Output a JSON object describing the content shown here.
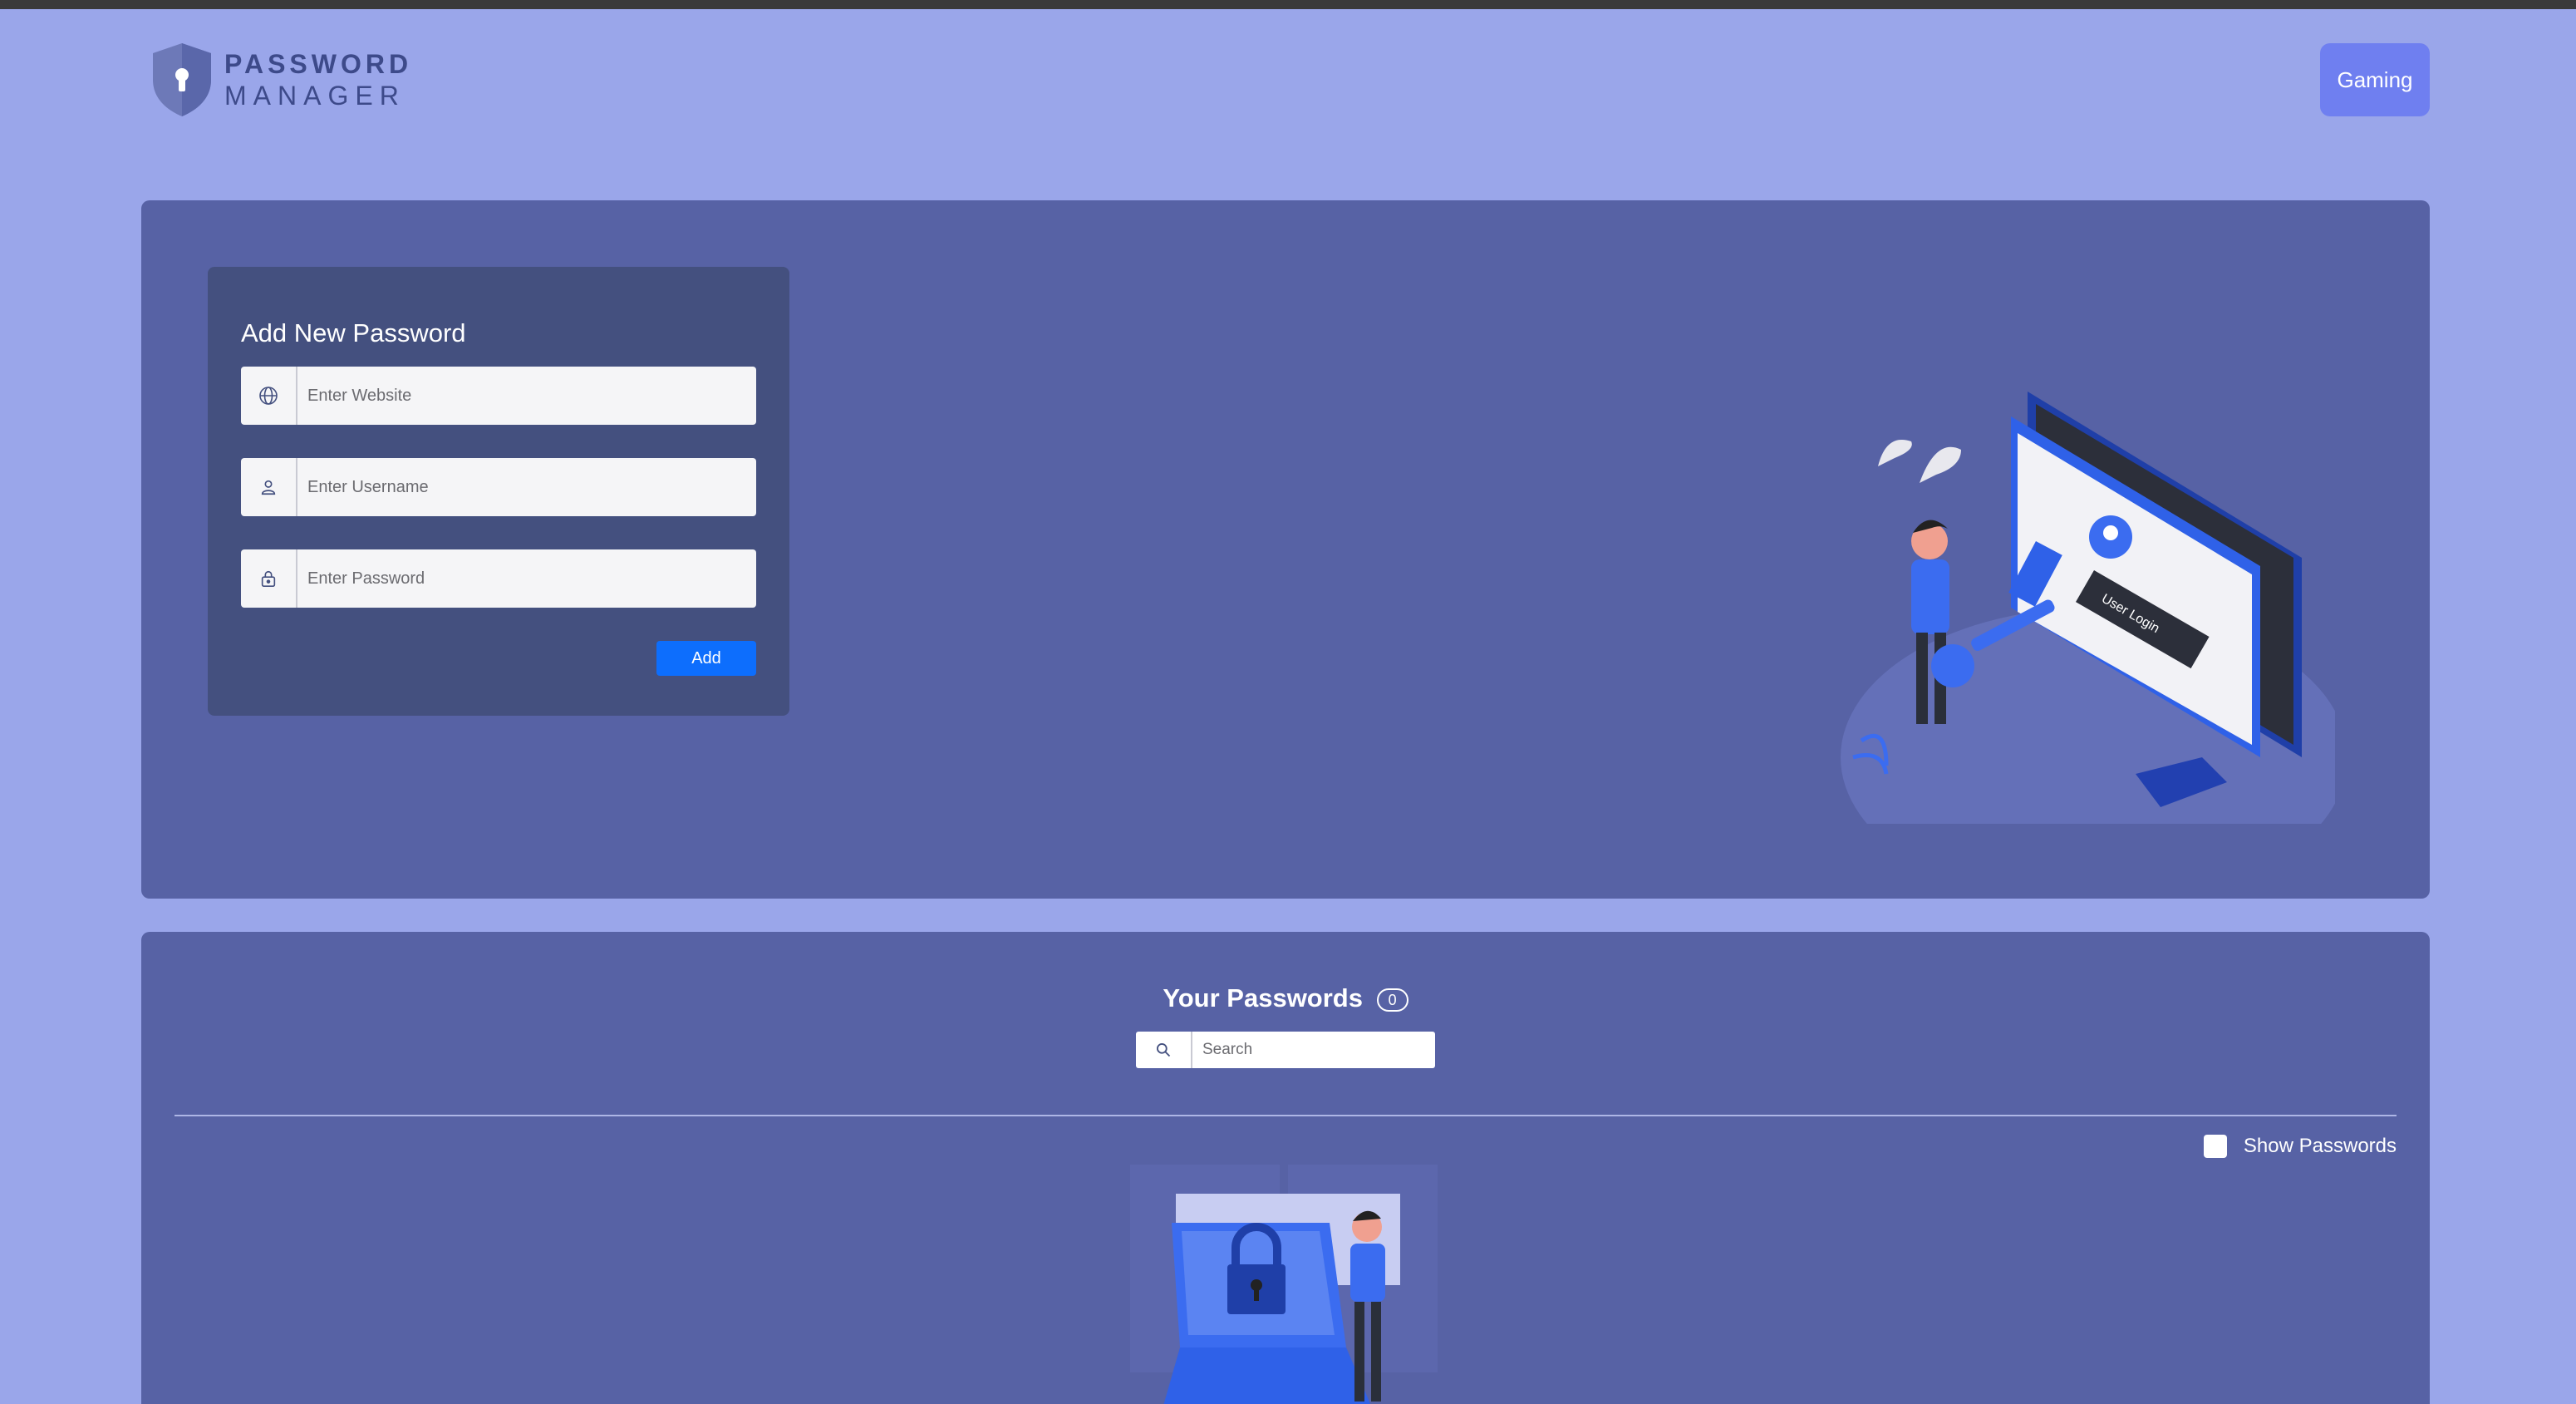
{
  "header": {
    "logo_line1": "PASSWORD",
    "logo_line2": "MANAGER",
    "logo_icon": "shield-keyhole-icon",
    "nav_button": "Gaming"
  },
  "add_form": {
    "title": "Add New Password",
    "website": {
      "placeholder": "Enter Website",
      "value": "",
      "icon": "globe-icon"
    },
    "username": {
      "placeholder": "Enter Username",
      "value": "",
      "icon": "user-icon"
    },
    "password": {
      "placeholder": "Enter Password",
      "value": "",
      "icon": "lock-icon"
    },
    "submit_label": "Add"
  },
  "hero_image": {
    "screen_text": "User Login"
  },
  "passwords": {
    "title": "Your Passwords",
    "count": "0",
    "search": {
      "placeholder": "Search",
      "value": "",
      "icon": "search-icon"
    },
    "show_passwords_label": "Show Passwords",
    "show_passwords_checked": false
  },
  "colors": {
    "background": "#9aa6ea",
    "panel": "#5762a5",
    "card": "#44507f",
    "accent_button": "#0d6efd",
    "nav_button": "#6f7ff0"
  }
}
